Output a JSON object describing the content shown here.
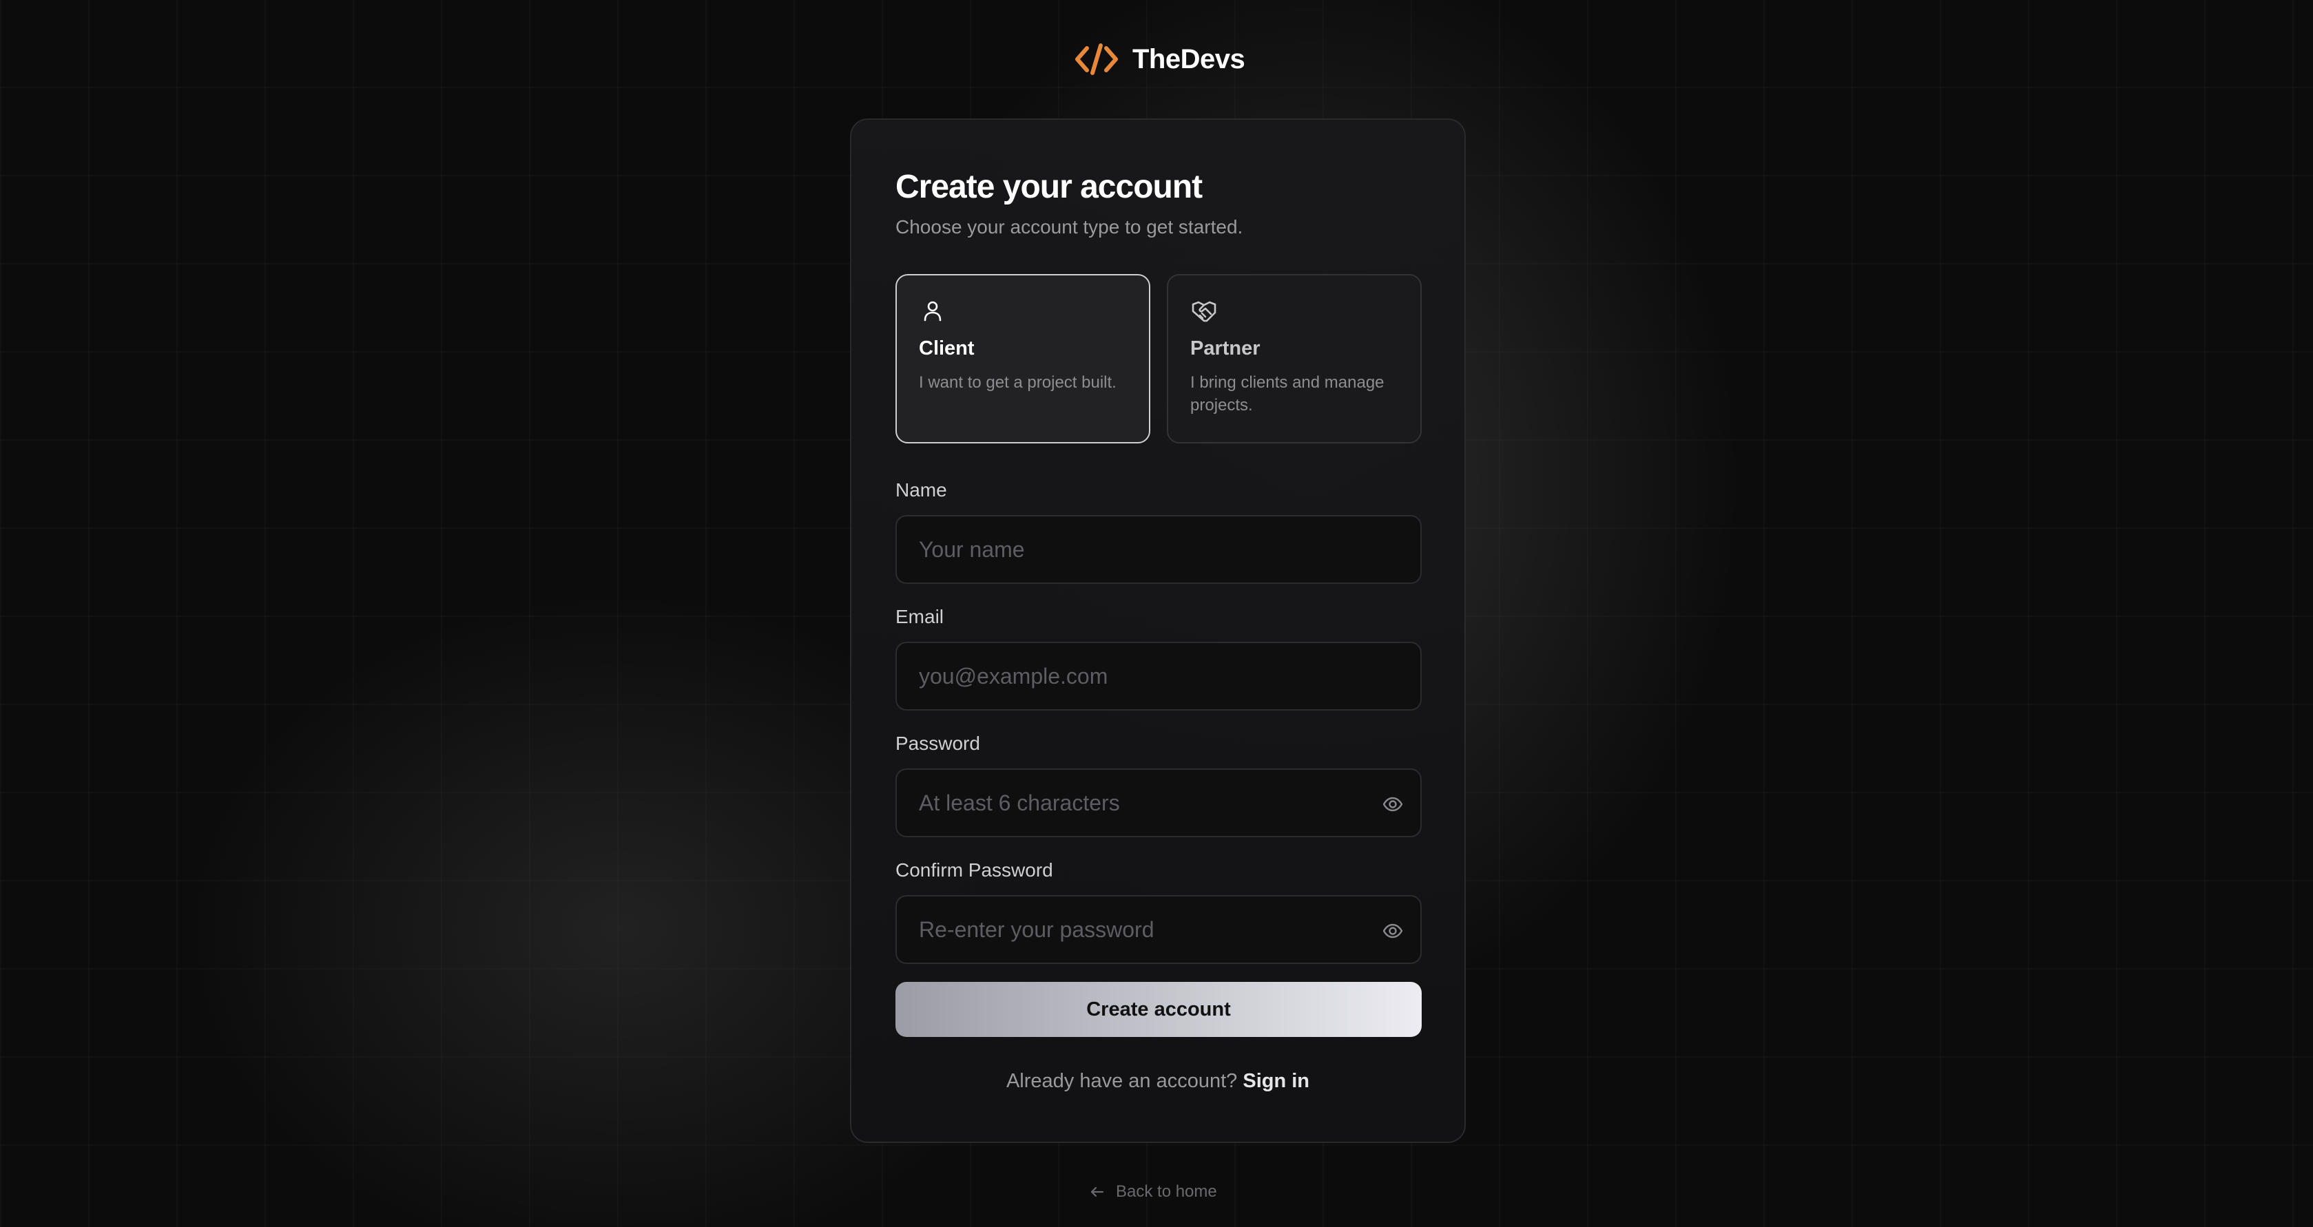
{
  "brand": {
    "name": "TheDevs",
    "accent": "#e8893a"
  },
  "form": {
    "title": "Create your account",
    "subtitle": "Choose your account type to get started.",
    "account_types": [
      {
        "title": "Client",
        "description": "I want to get a project built.",
        "icon": "user-icon",
        "selected": true
      },
      {
        "title": "Partner",
        "description": "I bring clients and manage projects.",
        "icon": "handshake-icon",
        "selected": false
      }
    ],
    "fields": {
      "name": {
        "label": "Name",
        "placeholder": "Your name",
        "value": ""
      },
      "email": {
        "label": "Email",
        "placeholder": "you@example.com",
        "value": ""
      },
      "password": {
        "label": "Password",
        "placeholder": "At least 6 characters",
        "value": "",
        "toggle_icon": "eye-icon"
      },
      "confirm_password": {
        "label": "Confirm Password",
        "placeholder": "Re-enter your password",
        "value": "",
        "toggle_icon": "eye-icon"
      }
    },
    "submit_label": "Create account",
    "signin_prompt": "Already have an account?",
    "signin_link": "Sign in"
  },
  "footer": {
    "back_label": "Back to home",
    "back_icon": "arrow-left-icon"
  }
}
